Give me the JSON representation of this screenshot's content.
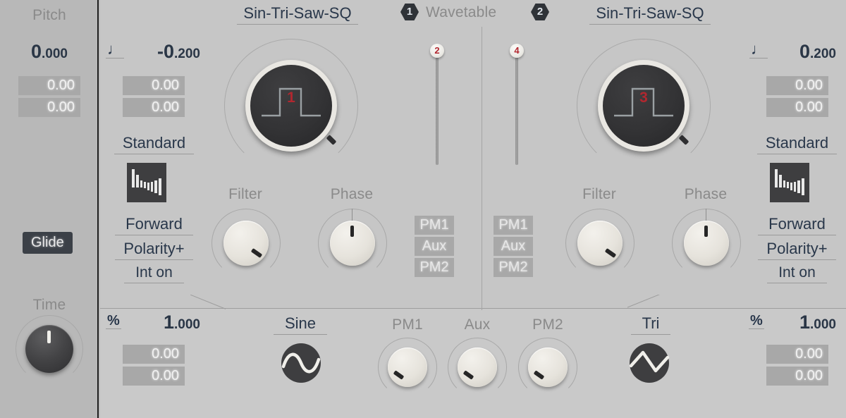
{
  "app": {
    "title": "Wavetable Oscillator Panel"
  },
  "header": {
    "wavetable_label": "Wavetable",
    "badge_1": "1",
    "badge_2": "2"
  },
  "pitch_rail": {
    "title": "Pitch",
    "value": "0.000",
    "value_int": "0",
    "value_frac": ".000",
    "mod1": "0.00",
    "mod2": "0.00",
    "glide_label": "Glide",
    "time_label": "Time"
  },
  "osc1": {
    "wavetable_name": "Sin-Tri-Saw-SQ",
    "note_value": "-0.200",
    "note_value_int": "-0",
    "note_value_frac": ".200",
    "note_icon": "quarter-note-icon",
    "note_mod1": "0.00",
    "note_mod2": "0.00",
    "mode_label": "Standard",
    "direction_label": "Forward",
    "polarity_label": "Polarity+",
    "interpolation_label": "Int on",
    "knob_number": "1",
    "knob_waveform": "square-wave-icon",
    "filter_label": "Filter",
    "phase_label": "Phase",
    "routing": [
      "PM1",
      "Aux",
      "PM2"
    ],
    "percent_icon": "percent-icon",
    "percent_value": "1.000",
    "percent_value_int": "1",
    "percent_value_frac": ".000",
    "percent_mod1": "0.00",
    "percent_mod2": "0.00"
  },
  "osc2": {
    "wavetable_name": "Sin-Tri-Saw-SQ",
    "note_value": "0.200",
    "note_value_int": "0",
    "note_value_frac": ".200",
    "note_icon": "quarter-note-icon",
    "note_mod1": "0.00",
    "note_mod2": "0.00",
    "mode_label": "Standard",
    "direction_label": "Forward",
    "polarity_label": "Polarity+",
    "interpolation_label": "Int on",
    "knob_number": "3",
    "knob_waveform": "square-wave-icon",
    "filter_label": "Filter",
    "phase_label": "Phase",
    "routing": [
      "PM1",
      "Aux",
      "PM2"
    ],
    "percent_icon": "percent-icon",
    "percent_value": "1.000",
    "percent_value_int": "1",
    "percent_value_frac": ".000",
    "percent_mod1": "0.00",
    "percent_mod2": "0.00"
  },
  "sliders": [
    {
      "name": "slider-2",
      "label": "2",
      "position_pct": 0
    },
    {
      "name": "slider-4",
      "label": "4",
      "position_pct": 0
    }
  ],
  "bottom_bar": {
    "sine_label": "Sine",
    "sine_icon": "sine-wave-icon",
    "tri_label": "Tri",
    "tri_icon": "triangle-wave-icon",
    "knobs": [
      {
        "label": "PM1"
      },
      {
        "label": "Aux"
      },
      {
        "label": "PM2"
      }
    ]
  },
  "colors": {
    "background": "#c6c6c6",
    "rail_background": "#b8b8b8",
    "accent_red": "#b1272f",
    "text_dark": "#29374a",
    "text_grey": "#8a8a8a",
    "value_box": "#a8a8a8",
    "dark_control": "#3b4047"
  }
}
